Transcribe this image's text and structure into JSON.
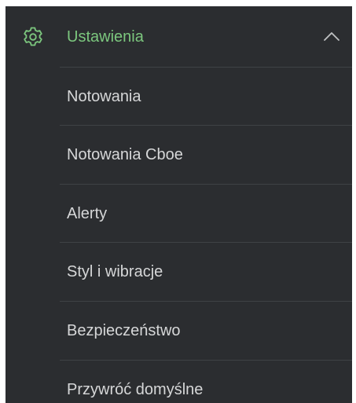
{
  "menu": {
    "header": {
      "label": "Ustawienia",
      "icon": "gear-icon",
      "expanded_icon": "chevron-up-icon",
      "accent_color": "#7cc77e"
    },
    "items": [
      {
        "label": "Notowania"
      },
      {
        "label": "Notowania Cboe"
      },
      {
        "label": "Alerty"
      },
      {
        "label": "Styl i wibracje"
      },
      {
        "label": "Bezpieczeństwo"
      },
      {
        "label": "Przywróć domyślne"
      }
    ]
  }
}
